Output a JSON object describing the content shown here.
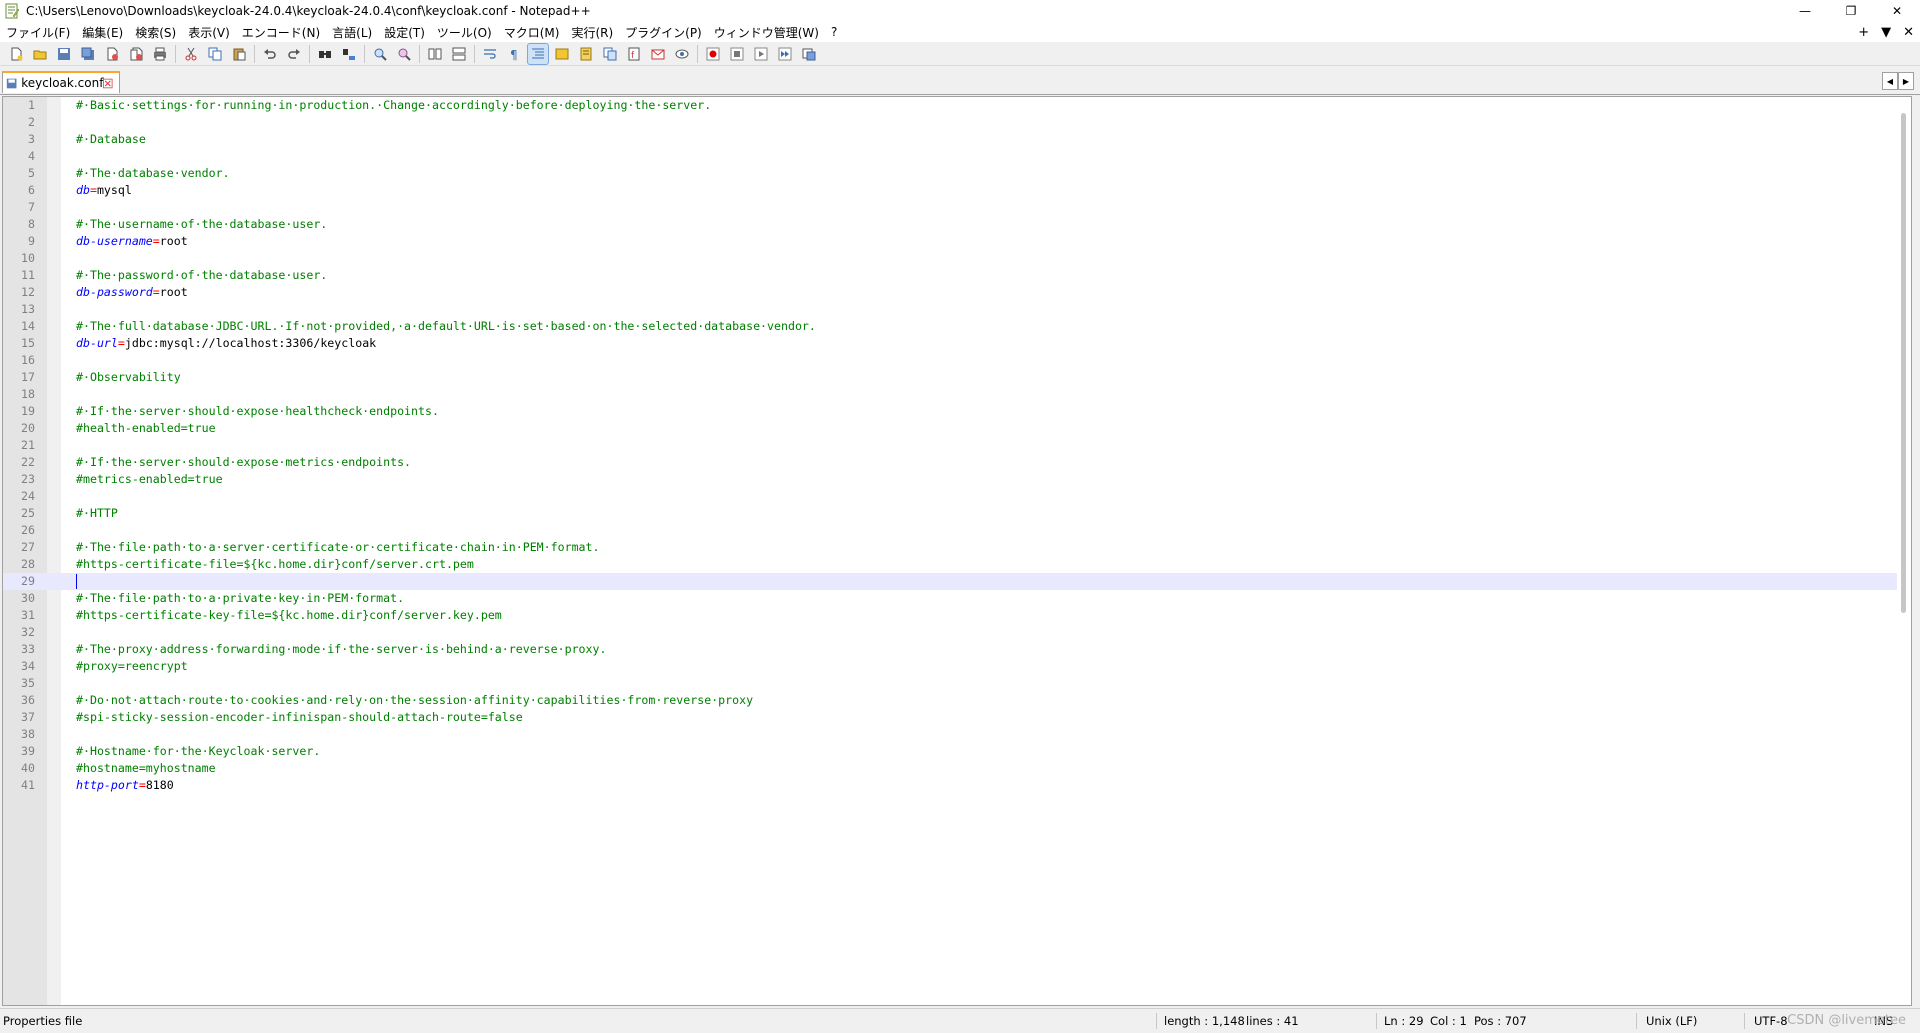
{
  "window": {
    "title": "C:\\Users\\Lenovo\\Downloads\\keycloak-24.0.4\\keycloak-24.0.4\\conf\\keycloak.conf - Notepad++",
    "controls": {
      "minimize": "—",
      "restore": "❐",
      "close": "✕"
    }
  },
  "menu": {
    "items": [
      "ファイル(F)",
      "編集(E)",
      "検索(S)",
      "表示(V)",
      "エンコード(N)",
      "言語(L)",
      "設定(T)",
      "ツール(O)",
      "マクロ(M)",
      "実行(R)",
      "プラグイン(P)",
      "ウィンドウ管理(W)",
      "?"
    ],
    "right": {
      "plus": "+",
      "dropdown": "▼",
      "close": "✕"
    }
  },
  "tab": {
    "label": "keycloak.conf"
  },
  "editor": {
    "current_line": 29,
    "lines": [
      [
        {
          "t": "c",
          "v": "#·Basic·settings·for·running·in·production.·Change·accordingly·before·deploying·the·server."
        }
      ],
      [],
      [
        {
          "t": "c",
          "v": "#·Database"
        }
      ],
      [],
      [
        {
          "t": "c",
          "v": "#·The·database·vendor."
        }
      ],
      [
        {
          "t": "k",
          "v": "db"
        },
        {
          "t": "e",
          "v": "="
        },
        {
          "t": "v",
          "v": "mysql"
        }
      ],
      [],
      [
        {
          "t": "c",
          "v": "#·The·username·of·the·database·user."
        }
      ],
      [
        {
          "t": "k",
          "v": "db-username"
        },
        {
          "t": "e",
          "v": "="
        },
        {
          "t": "v",
          "v": "root"
        }
      ],
      [],
      [
        {
          "t": "c",
          "v": "#·The·password·of·the·database·user."
        }
      ],
      [
        {
          "t": "k",
          "v": "db-password"
        },
        {
          "t": "e",
          "v": "="
        },
        {
          "t": "v",
          "v": "root"
        }
      ],
      [],
      [
        {
          "t": "c",
          "v": "#·The·full·database·JDBC·URL.·If·not·provided,·a·default·URL·is·set·based·on·the·selected·database·vendor."
        }
      ],
      [
        {
          "t": "k",
          "v": "db-url"
        },
        {
          "t": "e",
          "v": "="
        },
        {
          "t": "v",
          "v": "jdbc:mysql://localhost:3306/keycloak"
        }
      ],
      [],
      [
        {
          "t": "c",
          "v": "#·Observability"
        }
      ],
      [],
      [
        {
          "t": "c",
          "v": "#·If·the·server·should·expose·healthcheck·endpoints."
        }
      ],
      [
        {
          "t": "c",
          "v": "#health-enabled=true"
        }
      ],
      [],
      [
        {
          "t": "c",
          "v": "#·If·the·server·should·expose·metrics·endpoints."
        }
      ],
      [
        {
          "t": "c",
          "v": "#metrics-enabled=true"
        }
      ],
      [],
      [
        {
          "t": "c",
          "v": "#·HTTP"
        }
      ],
      [],
      [
        {
          "t": "c",
          "v": "#·The·file·path·to·a·server·certificate·or·certificate·chain·in·PEM·format."
        }
      ],
      [
        {
          "t": "c",
          "v": "#https-certificate-file=${kc.home.dir}conf/server.crt.pem"
        }
      ],
      [],
      [
        {
          "t": "c",
          "v": "#·The·file·path·to·a·private·key·in·PEM·format."
        }
      ],
      [
        {
          "t": "c",
          "v": "#https-certificate-key-file=${kc.home.dir}conf/server.key.pem"
        }
      ],
      [],
      [
        {
          "t": "c",
          "v": "#·The·proxy·address·forwarding·mode·if·the·server·is·behind·a·reverse·proxy."
        }
      ],
      [
        {
          "t": "c",
          "v": "#proxy=reencrypt"
        }
      ],
      [],
      [
        {
          "t": "c",
          "v": "#·Do·not·attach·route·to·cookies·and·rely·on·the·session·affinity·capabilities·from·reverse·proxy"
        }
      ],
      [
        {
          "t": "c",
          "v": "#spi-sticky-session-encoder-infinispan-should-attach-route=false"
        }
      ],
      [],
      [
        {
          "t": "c",
          "v": "#·Hostname·for·the·Keycloak·server."
        }
      ],
      [
        {
          "t": "c",
          "v": "#hostname=myhostname"
        }
      ],
      [
        {
          "t": "k",
          "v": "http-port"
        },
        {
          "t": "e",
          "v": "="
        },
        {
          "t": "v",
          "v": "8180"
        }
      ]
    ]
  },
  "status": {
    "file_type": "Properties file",
    "length": "length : 1,148",
    "lines": "lines : 41",
    "ln": "Ln : 29",
    "col": "Col : 1",
    "pos": "Pos : 707",
    "eol": "Unix (LF)",
    "encoding": "UTF-8",
    "mode": "INS",
    "watermark": "CSDN @livemetee"
  },
  "colors": {
    "comment": "#008000",
    "key": "#0000ff",
    "operator": "#ff0000",
    "current_line": "#e8e8ff",
    "tab_accent": "#fba72c"
  }
}
